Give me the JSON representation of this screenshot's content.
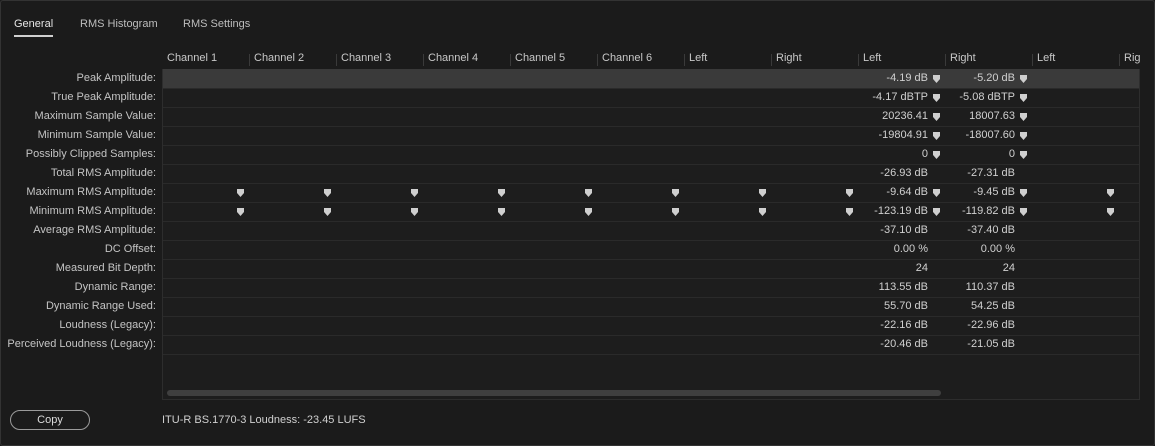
{
  "tabs": [
    {
      "label": "General",
      "active": true
    },
    {
      "label": "RMS Histogram",
      "active": false
    },
    {
      "label": "RMS Settings",
      "active": false
    }
  ],
  "columns": [
    "Channel 1",
    "Channel 2",
    "Channel 3",
    "Channel 4",
    "Channel 5",
    "Channel 6",
    "Left",
    "Right",
    "Left",
    "Right",
    "Left",
    "Rig"
  ],
  "rows": [
    {
      "label": "Peak Amplitude:",
      "left": "-4.19 dB",
      "right": "-5.20 dB",
      "markers": "lr",
      "highlight": true
    },
    {
      "label": "True Peak Amplitude:",
      "left": "-4.17 dBTP",
      "right": "-5.08 dBTP",
      "markers": "lr"
    },
    {
      "label": "Maximum Sample Value:",
      "left": "20236.41",
      "right": "18007.63",
      "markers": "lr"
    },
    {
      "label": "Minimum Sample Value:",
      "left": "-19804.91",
      "right": "-18007.60",
      "markers": "lr"
    },
    {
      "label": "Possibly Clipped Samples:",
      "left": "0",
      "right": "0",
      "markers": "lr"
    },
    {
      "label": "Total RMS Amplitude:",
      "left": "-26.93 dB",
      "right": "-27.31 dB",
      "markers": ""
    },
    {
      "label": "Maximum RMS Amplitude:",
      "left": "-9.64 dB",
      "right": "-9.45 dB",
      "markers": "all"
    },
    {
      "label": "Minimum RMS Amplitude:",
      "left": "-123.19 dB",
      "right": "-119.82 dB",
      "markers": "all"
    },
    {
      "label": "Average RMS Amplitude:",
      "left": "-37.10 dB",
      "right": "-37.40 dB",
      "markers": ""
    },
    {
      "label": "DC Offset:",
      "left": "0.00 %",
      "right": "0.00 %",
      "markers": ""
    },
    {
      "label": "Measured Bit Depth:",
      "left": "24",
      "right": "24",
      "markers": ""
    },
    {
      "label": "Dynamic Range:",
      "left": "113.55 dB",
      "right": "110.37 dB",
      "markers": ""
    },
    {
      "label": "Dynamic Range Used:",
      "left": "55.70 dB",
      "right": "54.25 dB",
      "markers": ""
    },
    {
      "label": "Loudness (Legacy):",
      "left": "-22.16 dB",
      "right": "-22.96 dB",
      "markers": ""
    },
    {
      "label": "Perceived Loudness (Legacy):",
      "left": "-20.46 dB",
      "right": "-21.05 dB",
      "markers": ""
    }
  ],
  "footer": {
    "copy_label": "Copy",
    "loudness_text": "ITU-R BS.1770-3 Loudness:  -23.45 LUFS"
  },
  "marker_icon": "playhead-marker-icon"
}
